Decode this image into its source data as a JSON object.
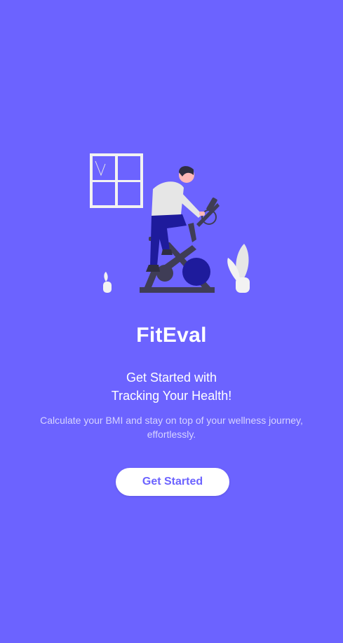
{
  "app": {
    "name": "FitEval"
  },
  "onboarding": {
    "headline_line1": "Get Started with",
    "headline_line2": "Tracking Your Health!",
    "subtitle": "Calculate your BMI and stay on top of your wellness journey, effortlessly.",
    "cta_label": "Get Started"
  },
  "illustration": {
    "icon": "person-on-exercise-bike-illustration"
  },
  "colors": {
    "background": "#6C63FF",
    "button_bg": "#FFFFFF",
    "button_text": "#6C63FF",
    "subtitle_text": "#D7D4FF",
    "illustration_dark": "#3F3D56",
    "illustration_accent": "#1E1B9C"
  }
}
